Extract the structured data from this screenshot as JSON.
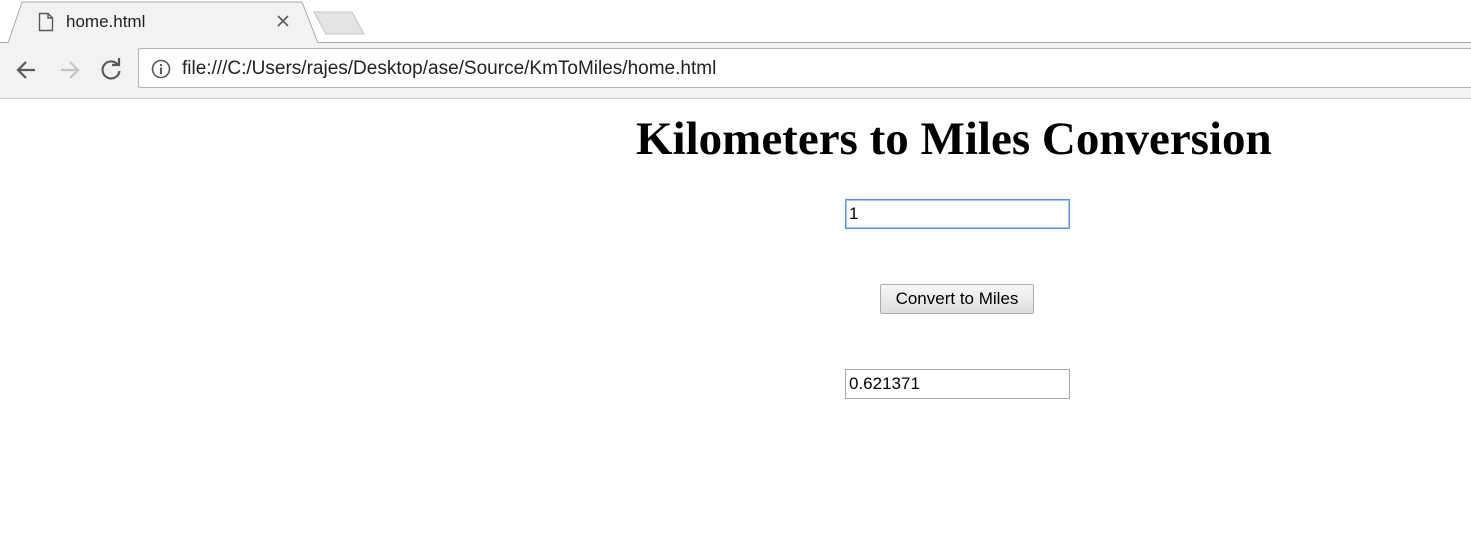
{
  "browser": {
    "tab": {
      "title": "home.html",
      "favicon": "page-icon",
      "close_icon": "close-icon"
    },
    "new_tab_icon": "new-tab-icon",
    "nav": {
      "back_icon": "back-arrow-icon",
      "forward_icon": "forward-arrow-icon",
      "reload_icon": "reload-icon"
    },
    "address": {
      "info_icon": "info-icon",
      "url": "file:///C:/Users/rajes/Desktop/ase/Source/KmToMiles/home.html"
    }
  },
  "page": {
    "title": "Kilometers to Miles Conversion",
    "km_input": {
      "value": "1"
    },
    "convert_button_label": "Convert to Miles",
    "miles_output": {
      "value": "0.621371"
    }
  },
  "colors": {
    "focus_border": "#4d90fe",
    "toolbar_bg": "#f2f2f2",
    "page_bg": "#ffffff"
  }
}
